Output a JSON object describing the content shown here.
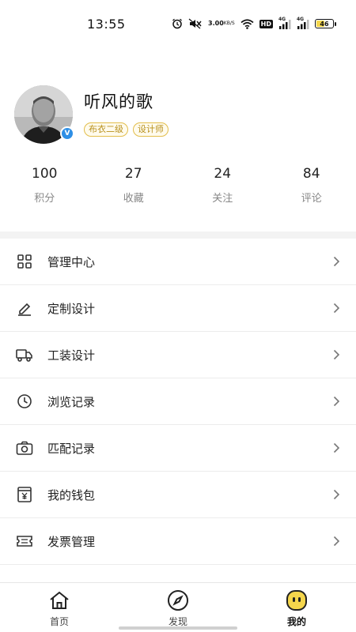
{
  "status_bar": {
    "time": "13:55",
    "net_speed_value": "3.00",
    "net_speed_unit": "KB/S",
    "hd_label": "HD",
    "signal_1_label": "4G",
    "signal_2_label": "4G",
    "battery_level": "46",
    "icons": [
      "alarm-icon",
      "mute-icon",
      "wifi-icon",
      "signal-icon",
      "battery-icon"
    ]
  },
  "profile": {
    "name": "听风的歌",
    "verified_badge": "V",
    "tags": [
      "布衣二级",
      "设计师"
    ]
  },
  "stats": [
    {
      "value": "100",
      "label": "积分"
    },
    {
      "value": "27",
      "label": "收藏"
    },
    {
      "value": "24",
      "label": "关注"
    },
    {
      "value": "84",
      "label": "评论"
    }
  ],
  "menu": {
    "items": [
      {
        "label": "管理中心",
        "icon": "grid-icon"
      },
      {
        "label": "定制设计",
        "icon": "pencil-icon"
      },
      {
        "label": "工装设计",
        "icon": "truck-icon"
      },
      {
        "label": "浏览记录",
        "icon": "clock-icon"
      },
      {
        "label": "匹配记录",
        "icon": "camera-icon"
      },
      {
        "label": "我的钱包",
        "icon": "wallet-icon"
      },
      {
        "label": "发票管理",
        "icon": "ticket-icon"
      }
    ]
  },
  "tab_bar": {
    "tabs": [
      {
        "label": "首页",
        "icon": "home-icon"
      },
      {
        "label": "发现",
        "icon": "compass-icon"
      },
      {
        "label": "我的",
        "icon": "smiley-icon",
        "active": true
      }
    ]
  },
  "colors": {
    "accent_yellow": "#f5d64c",
    "tag_gold": "#b8901c",
    "verified_blue": "#2e8fe6"
  }
}
